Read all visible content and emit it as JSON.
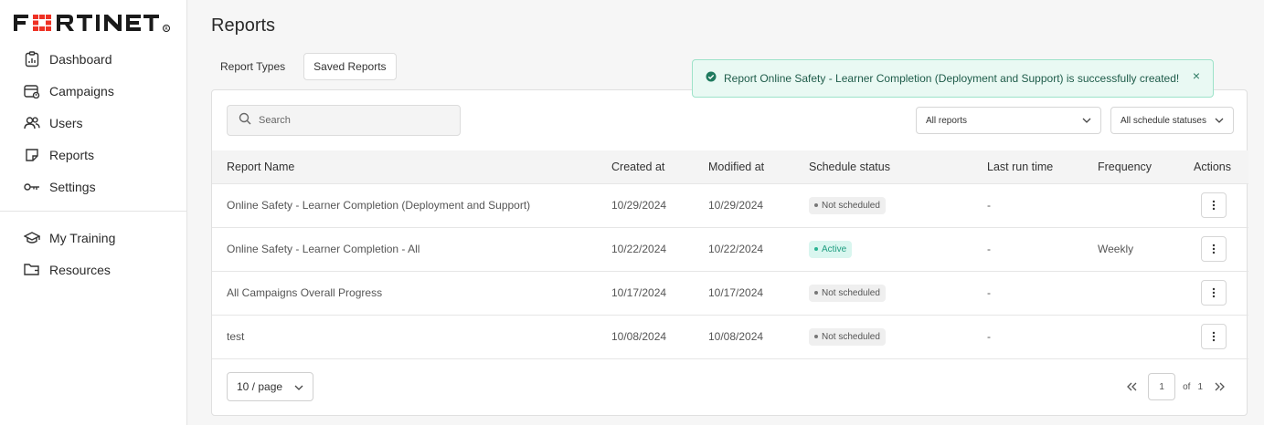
{
  "brand": {
    "logo_text": "FORTINET",
    "accent": "#ee3124"
  },
  "sidebar": {
    "items": [
      {
        "label": "Dashboard",
        "icon": "dashboard-icon"
      },
      {
        "label": "Campaigns",
        "icon": "campaigns-icon"
      },
      {
        "label": "Users",
        "icon": "users-icon"
      },
      {
        "label": "Reports",
        "icon": "reports-icon"
      },
      {
        "label": "Settings",
        "icon": "key-icon"
      }
    ],
    "secondary_items": [
      {
        "label": "My Training",
        "icon": "graduation-cap-icon"
      },
      {
        "label": "Resources",
        "icon": "folder-icon"
      }
    ]
  },
  "page": {
    "title": "Reports"
  },
  "tabs": [
    {
      "label": "Report Types",
      "active": false
    },
    {
      "label": "Saved Reports",
      "active": true
    }
  ],
  "toast": {
    "message": "Report Online Safety - Learner Completion (Deployment and Support) is successfully created!",
    "close_symbol": "×",
    "status_color": "#1f7a5e"
  },
  "filters": {
    "search_placeholder": "Search",
    "reports_select": "All reports",
    "status_select": "All schedule statuses"
  },
  "table": {
    "columns": [
      "Report Name",
      "Created at",
      "Modified at",
      "Schedule status",
      "Last run time",
      "Frequency",
      "Actions"
    ],
    "rows": [
      {
        "name": "Online Safety - Learner Completion (Deployment and Support)",
        "created": "10/29/2024",
        "modified": "10/29/2024",
        "status": "Not scheduled",
        "status_type": "inactive",
        "last_run": "-",
        "frequency": ""
      },
      {
        "name": "Online Safety - Learner Completion - All",
        "created": "10/22/2024",
        "modified": "10/22/2024",
        "status": "Active",
        "status_type": "active",
        "last_run": "-",
        "frequency": "Weekly"
      },
      {
        "name": "All Campaigns Overall Progress",
        "created": "10/17/2024",
        "modified": "10/17/2024",
        "status": "Not scheduled",
        "status_type": "inactive",
        "last_run": "-",
        "frequency": ""
      },
      {
        "name": "test",
        "created": "10/08/2024",
        "modified": "10/08/2024",
        "status": "Not scheduled",
        "status_type": "inactive",
        "last_run": "-",
        "frequency": ""
      }
    ]
  },
  "pagination": {
    "page_size": "10 / page",
    "current_page": "1",
    "of_label": "of",
    "total_pages": "1"
  }
}
